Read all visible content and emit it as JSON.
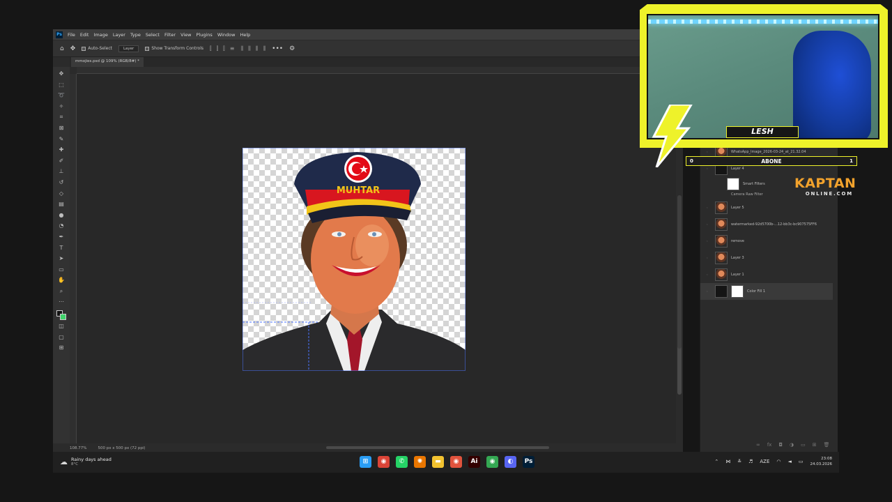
{
  "photoshop": {
    "logo": "Ps",
    "menu": [
      "File",
      "Edit",
      "Image",
      "Layer",
      "Type",
      "Select",
      "Filter",
      "View",
      "Plugins",
      "Window",
      "Help"
    ],
    "options": {
      "auto_select_label": "Auto-Select",
      "auto_select_value": "Layer",
      "transform_label": "Show Transform Controls",
      "more_label": "•••"
    },
    "document_tab": "mmojies.psd @ 109% (RGB/8#) *",
    "status": {
      "zoom": "108.77%",
      "size": "500 px x 500 px (72 ppi)"
    },
    "canvas_text": {
      "cap_badge": "MUHTAR"
    }
  },
  "layers_panel": {
    "layers": [
      {
        "name": "WhatsApp_Image_2026-03-24_at_21.32.04",
        "thumb": "face"
      },
      {
        "name": "Layer 4",
        "thumb": "dark"
      },
      {
        "name": "Smart Filters",
        "thumb": "white",
        "sub": "Camera Raw Filter"
      },
      {
        "name": "Layer 5",
        "thumb": "face"
      },
      {
        "name": "watermarked-92d5700b-...12-bb3c-bc907575FF6",
        "thumb": "face"
      },
      {
        "name": "remove",
        "thumb": "face"
      },
      {
        "name": "Layer 3",
        "thumb": "face"
      },
      {
        "name": "Layer 1",
        "thumb": "face"
      },
      {
        "name": "Color Fill 1",
        "thumb": "dark"
      }
    ]
  },
  "taskbar": {
    "weather": {
      "text": "Rainy days ahead",
      "temp": "8°C",
      "icon": "cloud-rain-icon"
    },
    "apps": [
      {
        "name": "windows-start-icon",
        "color": "#2a9df4",
        "glyph": "⊞"
      },
      {
        "name": "chrome-icon",
        "color": "#db4437",
        "glyph": "◉"
      },
      {
        "name": "whatsapp-icon",
        "color": "#25d366",
        "glyph": "✆"
      },
      {
        "name": "blender-icon",
        "color": "#ea7600",
        "glyph": "✺"
      },
      {
        "name": "file-explorer-icon",
        "color": "#f2c230",
        "glyph": "▬"
      },
      {
        "name": "chrome-alt-icon",
        "color": "#e0533d",
        "glyph": "◉"
      },
      {
        "name": "illustrator-icon",
        "color": "#330000",
        "glyph": "Ai"
      },
      {
        "name": "chrome-third-icon",
        "color": "#34a853",
        "glyph": "◉"
      },
      {
        "name": "discord-icon",
        "color": "#5865f2",
        "glyph": "◐"
      },
      {
        "name": "photoshop-task-icon",
        "color": "#001e36",
        "glyph": "Ps"
      }
    ],
    "tray": {
      "lang": "AZE",
      "time": "23:08",
      "date": "24.03.2026"
    }
  },
  "overlay": {
    "streamer_name": "LESH",
    "sub_goal": {
      "current": "0",
      "label": "ABONE",
      "target": "1",
      "progress": 0.0
    },
    "brand": {
      "main": "KAPTAN",
      "sub": "ONLINE.COM"
    },
    "accent": "#eef22a"
  }
}
